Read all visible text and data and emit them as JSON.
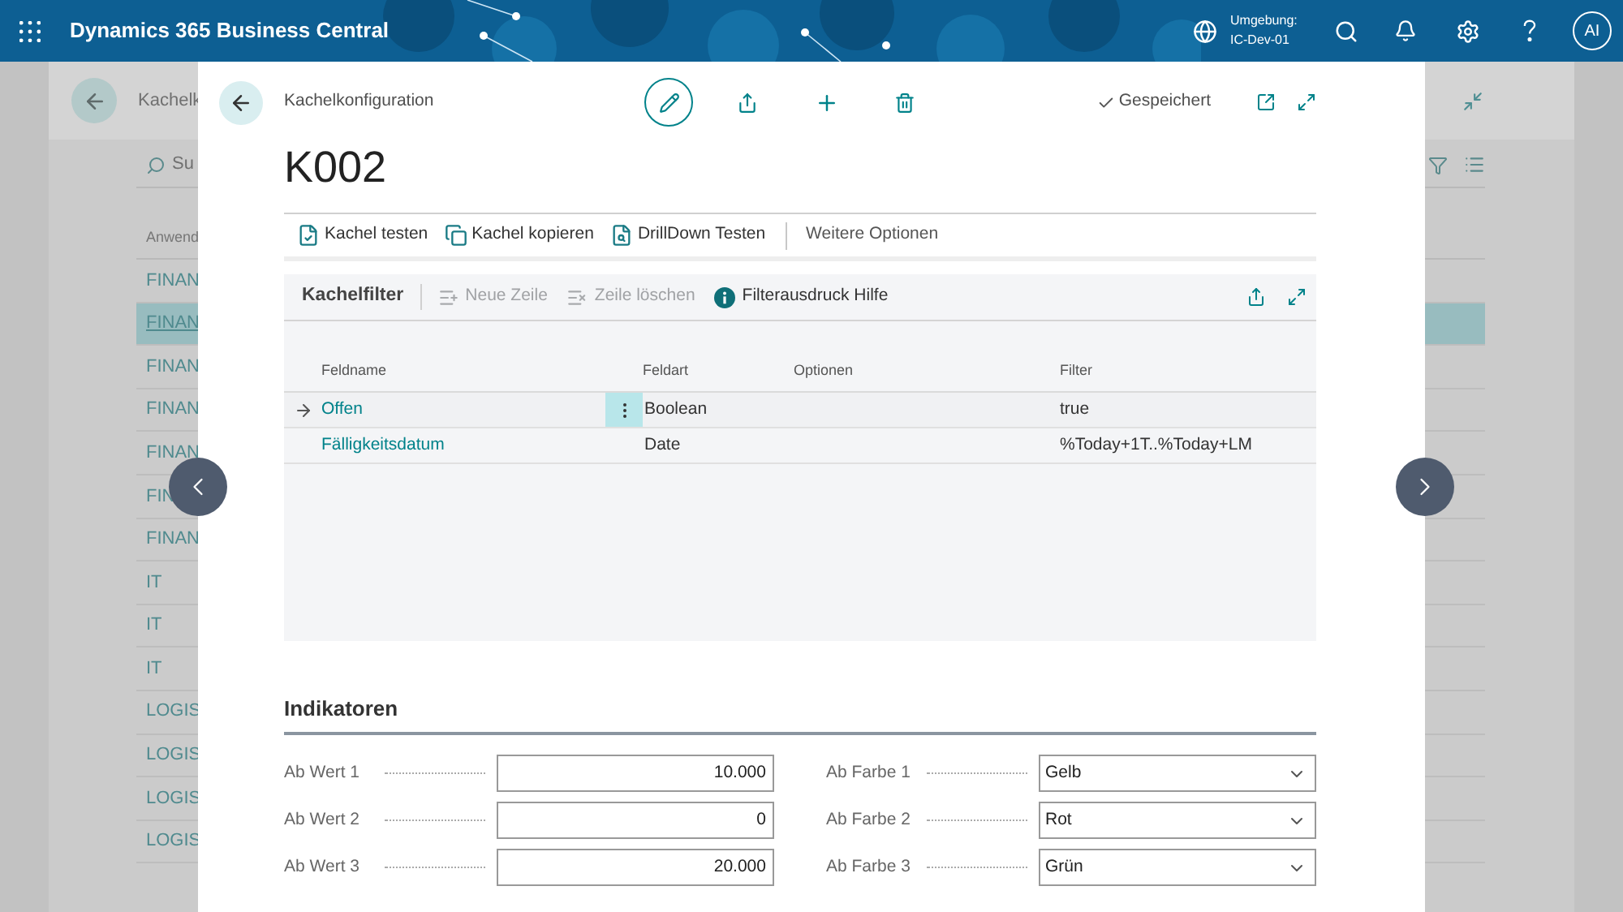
{
  "app_bar": {
    "title": "Dynamics 365 Business Central",
    "environment_label": "Umgebung:",
    "environment": "IC-Dev-01",
    "avatar": "AI"
  },
  "background_page": {
    "title": "Kachelk",
    "search": "Su",
    "column": "Anwend",
    "rows": [
      {
        "text": "FINAN",
        "selected": false
      },
      {
        "text": "FINAN",
        "selected": true
      },
      {
        "text": "FINAN",
        "selected": false
      },
      {
        "text": "FINAN",
        "selected": false
      },
      {
        "text": "FINAN",
        "selected": false
      },
      {
        "text": "FIN",
        "selected": false
      },
      {
        "text": "FINAN",
        "selected": false
      },
      {
        "text": "IT",
        "selected": false
      },
      {
        "text": "IT",
        "selected": false
      },
      {
        "text": "IT",
        "selected": false
      },
      {
        "text": "LOGIS",
        "selected": false
      },
      {
        "text": "LOGIS",
        "selected": false
      },
      {
        "text": "LOGIS",
        "selected": false
      },
      {
        "text": "LOGIS",
        "selected": false
      }
    ]
  },
  "dialog": {
    "caption": "Kachelkonfiguration",
    "title": "K002",
    "status": "Gespeichert",
    "actions": [
      {
        "label": "Kachel testen",
        "kind": "test"
      },
      {
        "label": "Kachel kopieren",
        "kind": "copy"
      },
      {
        "label": "DrillDown Testen",
        "kind": "drilldown"
      }
    ],
    "more": "Weitere Optionen",
    "filter_part": {
      "title": "Kachelfilter",
      "actions": [
        {
          "label": "Neue Zeile",
          "kind": "new",
          "disabled": true
        },
        {
          "label": "Zeile löschen",
          "kind": "delete",
          "disabled": true
        },
        {
          "label": "Filterausdruck Hilfe",
          "kind": "info",
          "disabled": false
        }
      ],
      "columns": [
        "Feldname",
        "Feldart",
        "Optionen",
        "Filter"
      ],
      "rows": [
        {
          "field": "Offen",
          "type": "Boolean",
          "filter": "true",
          "selected": true
        },
        {
          "field": "Fälligkeitsdatum",
          "type": "Date",
          "filter": "%Today+1T..%Today+LM",
          "selected": false
        }
      ]
    },
    "indicators": {
      "title": "Indikatoren",
      "values": [
        {
          "label": "Ab Wert 1",
          "value": "10.000"
        },
        {
          "label": "Ab Wert 2",
          "value": "0"
        },
        {
          "label": "Ab Wert 3",
          "value": "20.000"
        }
      ],
      "colors": [
        {
          "label": "Ab Farbe 1",
          "value": "Gelb"
        },
        {
          "label": "Ab Farbe 2",
          "value": "Rot"
        },
        {
          "label": "Ab Farbe 3",
          "value": "Grün"
        }
      ]
    }
  }
}
